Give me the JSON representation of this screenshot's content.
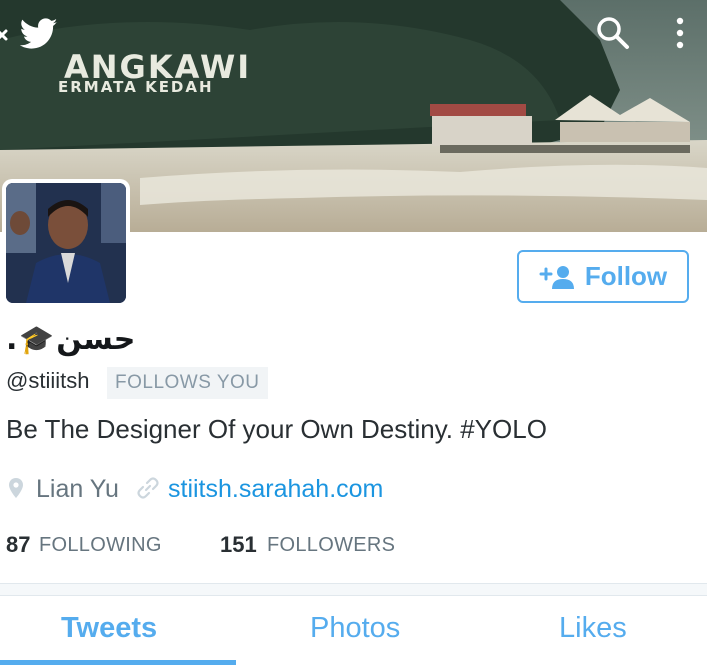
{
  "header": {
    "cover_text_line1": "ANGKAWI",
    "cover_text_line2": "ERMATA KEDAH",
    "icons": [
      "close-icon",
      "twitter-bird-icon",
      "search-icon",
      "more-vert-icon"
    ]
  },
  "profile": {
    "name": "حسن",
    "name_suffix": ".",
    "name_emoji": "🎓",
    "handle": "@stiiitsh",
    "follows_you": "FOLLOWS YOU",
    "bio": "Be The Designer Of your Own Destiny. #YOLO",
    "location": "Lian Yu",
    "website": "stiitsh.sarahah.com"
  },
  "follow_button": {
    "label": "Follow"
  },
  "stats": {
    "following_count": "87",
    "following_label": "FOLLOWING",
    "followers_count": "151",
    "followers_label": "FOLLOWERS"
  },
  "tabs": [
    {
      "label": "Tweets",
      "active": true
    },
    {
      "label": "Photos",
      "active": false
    },
    {
      "label": "Likes",
      "active": false
    }
  ],
  "colors": {
    "accent": "#55acee",
    "link": "#1b95e0",
    "muted": "#66757f"
  }
}
